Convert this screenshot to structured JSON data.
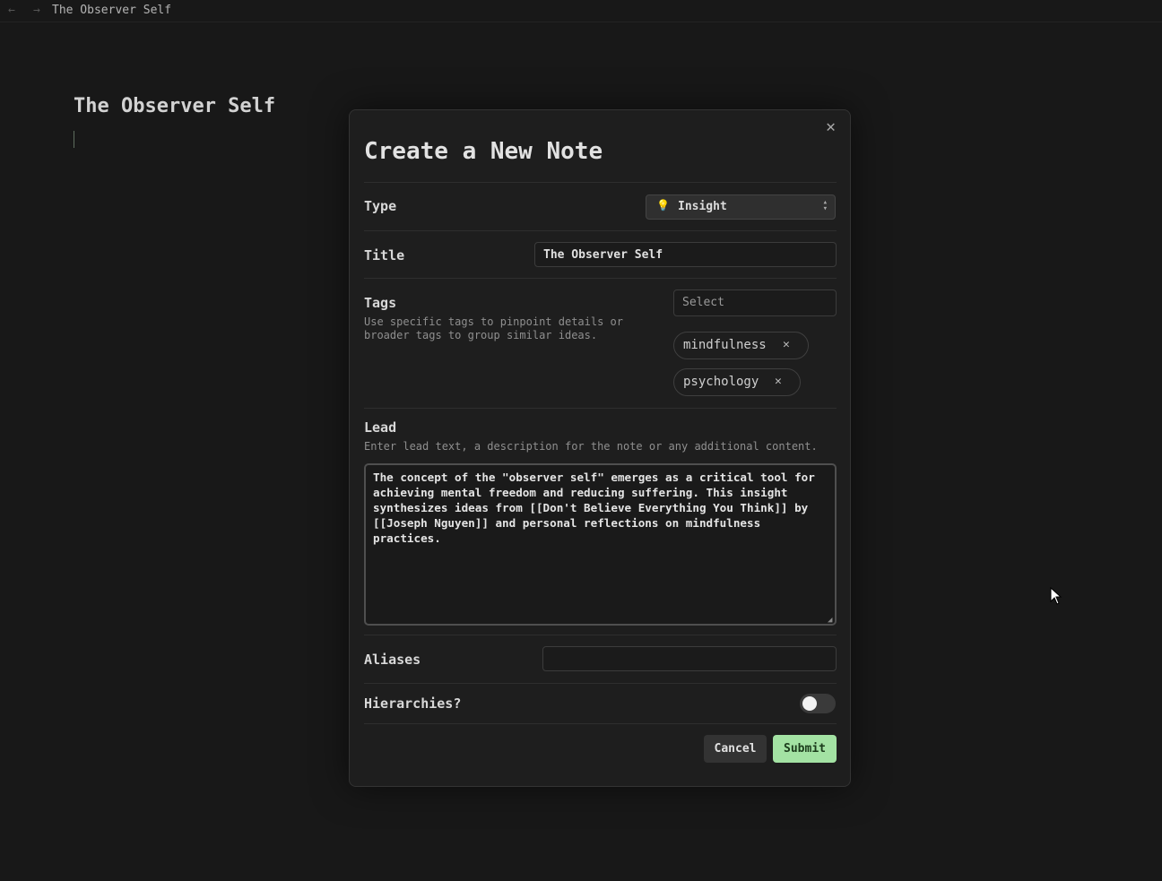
{
  "breadcrumb": {
    "back_icon": "arrow-left-icon",
    "forward_icon": "arrow-right-icon",
    "title": "The Observer Self"
  },
  "document": {
    "title": "The Observer Self"
  },
  "modal": {
    "close_icon": "close-icon",
    "title": "Create a New Note",
    "type": {
      "label": "Type",
      "value": "Insight",
      "icon": "lightbulb-icon"
    },
    "title_field": {
      "label": "Title",
      "value": "The Observer Self"
    },
    "tags": {
      "label": "Tags",
      "description_line1": "Use specific tags to pinpoint details or",
      "description_line2": "broader tags to group similar ideas.",
      "select_placeholder": "Select",
      "chips": [
        "mindfulness",
        "psychology"
      ]
    },
    "lead": {
      "label": "Lead",
      "description": "Enter lead text, a description for the note or any additional content.",
      "value": "The concept of the \"observer self\" emerges as a critical tool for\nachieving mental freedom and reducing suffering. This insight\nsynthesizes ideas from [[Don't Believe Everything You Think]] by\n[[Joseph Nguyen]] and personal reflections on mindfulness\npractices."
    },
    "aliases": {
      "label": "Aliases",
      "value": ""
    },
    "hierarchies": {
      "label": "Hierarchies?",
      "enabled": false
    },
    "buttons": {
      "cancel": "Cancel",
      "submit": "Submit"
    }
  },
  "colors": {
    "accent_submit": "#a3e2a3",
    "background": "#181818",
    "modal_bg": "#1e1e1e",
    "bulb": "#f2c94c"
  }
}
